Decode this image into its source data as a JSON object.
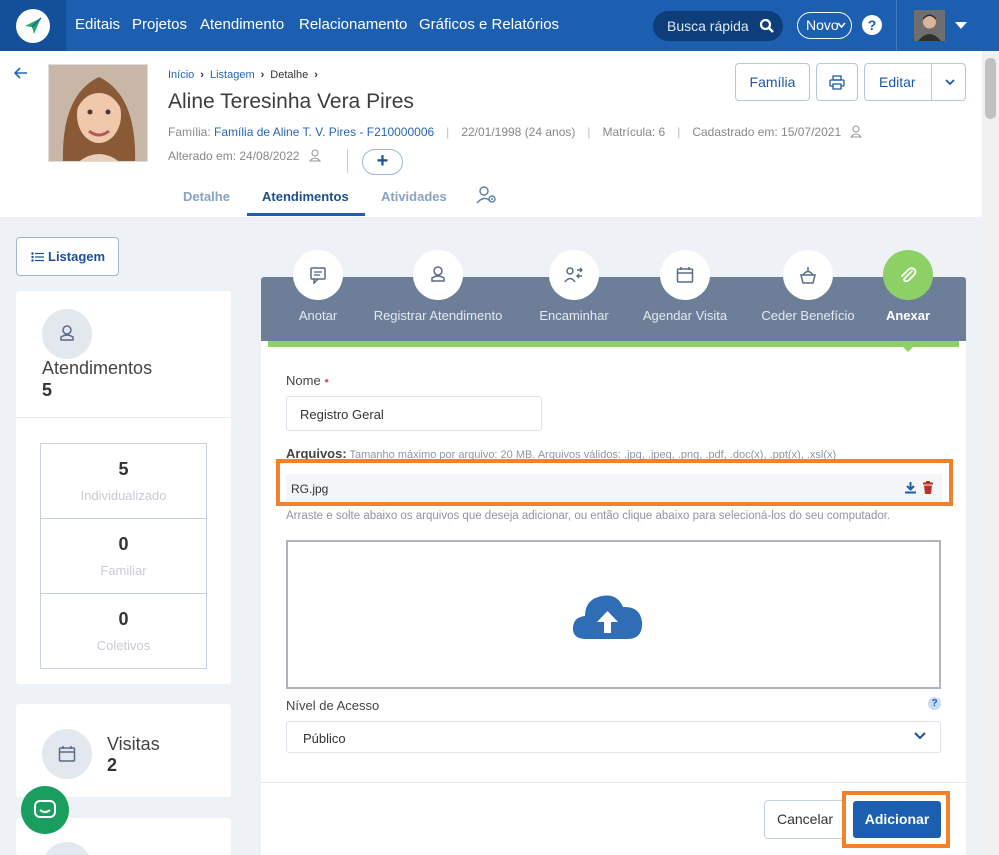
{
  "nav": {
    "items": [
      "Editais",
      "Projetos",
      "Atendimento",
      "Relacionamento",
      "Gráficos e Relatórios"
    ],
    "search_label": "Busca rápida",
    "novo_label": "Novo",
    "help_label": "?"
  },
  "breadcrumb": {
    "inicio": "Início",
    "listagem": "Listagem",
    "detalhe": "Detalhe"
  },
  "person": {
    "name": "Aline Teresinha Vera Pires",
    "familia_label": "Família:",
    "familia_value": "Família de Aline T. V. Pires - F210000006",
    "birth": "22/01/1998 (24 anos)",
    "matricula": "Matrícula: 6",
    "cadastrado": "Cadastrado em: 15/07/2021",
    "alterado": "Alterado em: 24/08/2022"
  },
  "header_buttons": {
    "familia": "Família",
    "editar": "Editar",
    "add": "+"
  },
  "tabs": [
    "Detalhe",
    "Atendimentos",
    "Atividades"
  ],
  "left": {
    "listagem_label": "Listagem",
    "atendimentos_title": "Atendimentos",
    "atendimentos_count": "5",
    "stats": [
      {
        "value": "5",
        "label": "Individualizado"
      },
      {
        "value": "0",
        "label": "Familiar"
      },
      {
        "value": "0",
        "label": "Coletivos"
      }
    ],
    "visitas_title": "Visitas",
    "visitas_count": "2"
  },
  "actions": [
    "Anotar",
    "Registrar Atendimento",
    "Encaminhar",
    "Agendar Visita",
    "Ceder Benefício",
    "Anexar"
  ],
  "form": {
    "nome_label": "Nome",
    "nome_value": "Registro Geral",
    "arquivos_label": "Arquivos:",
    "arquivos_hint": "Tamanho máximo por arquivo: 20 MB. Arquivos válidos: .jpg, .jpeg, .png, .pdf, .doc(x), .ppt(x), .xsl(x)",
    "file_name": "RG.jpg",
    "drop_hint": "Arraste e solte abaixo os arquivos que deseja adicionar, ou então clique abaixo para selecioná-los do seu computador.",
    "nivel_label": "Nível de Acesso",
    "nivel_value": "Público",
    "help": "?",
    "cancel": "Cancelar",
    "submit": "Adicionar"
  },
  "colors": {
    "nav": "#1c5fb0",
    "accent_green": "#8dd066",
    "highlight": "#f1822b"
  }
}
